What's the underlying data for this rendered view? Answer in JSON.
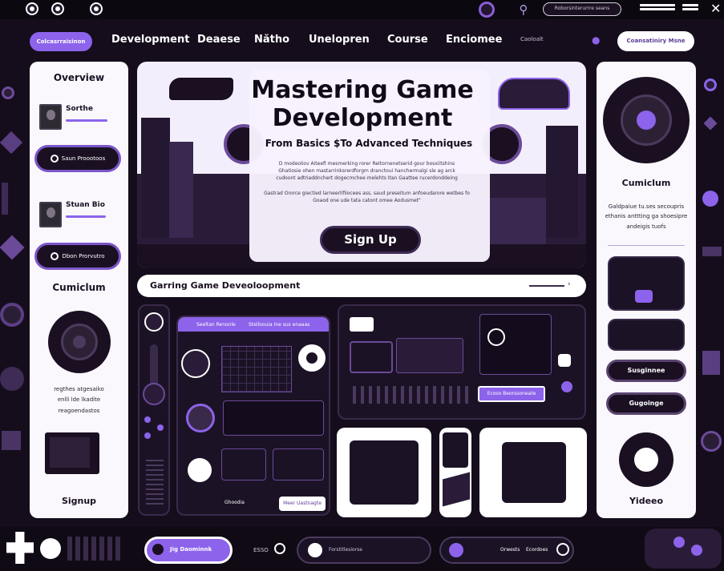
{
  "topbar": {
    "search_field_text": "Roborsinterurrre seans"
  },
  "nav": {
    "pill_label": "Colcasrraisinon",
    "items": [
      "Development",
      "Deaese",
      "Nătho",
      "Unelopren",
      "Course",
      "Enciomee"
    ],
    "util_text": "Caoloalt",
    "cta_label": "Coansatiniry Msne"
  },
  "left_panel": {
    "title": "Overview",
    "profile_1_name": "Sorthe",
    "profile_1_button": "Saun Proootoos",
    "profile_2_name": "Stuan Bio",
    "profile_2_button": "Dbon Prorvutro",
    "curriculum_title": "Cumiclum",
    "curriculum_text_1": "regthes atgesaiko",
    "curriculum_text_2": "enlli lde lkadite",
    "curriculum_text_3": "reagoendastos",
    "signup_label": "Signup"
  },
  "hero": {
    "title_line_1": "Mastering Game",
    "title_line_2": "Development",
    "subtitle": "From Basics $To Advanced Techniques",
    "body_line_1": "D modeoliov Aiteefi mesmerking rorer Reitornenetserid gour bosxiitshins",
    "body_line_2": "Ghatiosie ohen mastarrinksrerdforgm dranctoui hanchermalgi sle ag arck",
    "body_line_3": "cudoont adtriaddnchert dogecmchee melehts Itan Gaattee rucerdonddeing",
    "body_line_4": "Gastrad Ororce giectied larneerlifiiocees ass, saud preseitum anfoeudarore wetbes fo",
    "body_line_5": "Goaod one ude tata catont omee Aodusmet\"",
    "cta_label": "Sign Up"
  },
  "course_bar": {
    "label": "Garring Game Deveoloopment"
  },
  "mid_cards": {
    "tab_1": "Seeltan Renonle",
    "tab_2": "Stelloouia Ine sus enaaas",
    "bottom_chip": "Ghoodia",
    "bottom_button": "Meer Uastnagte",
    "console_button": "Ecoso Beorssoneate"
  },
  "right_panel": {
    "curriculum_title": "Cumiclum",
    "text_1": "Galdpaiue tu.ses secoupris",
    "text_2": "ethanis anttting ga shoesipre",
    "text_3": "andeigis tuofs",
    "button_1": "Susginnee",
    "button_2": "Gugoinge",
    "video_label": "Yideeo"
  },
  "footer": {
    "pill_label": "Jig Daominnk",
    "pill_counter": "ESSO",
    "media_text": "Forstitlesiorse",
    "stat_1": "Orwests",
    "stat_2": "Ecordoes"
  },
  "colors": {
    "background": "#150d1c",
    "accent": "#8c63ea",
    "panel": "#faf8fd",
    "dark_card": "#1c1226"
  }
}
